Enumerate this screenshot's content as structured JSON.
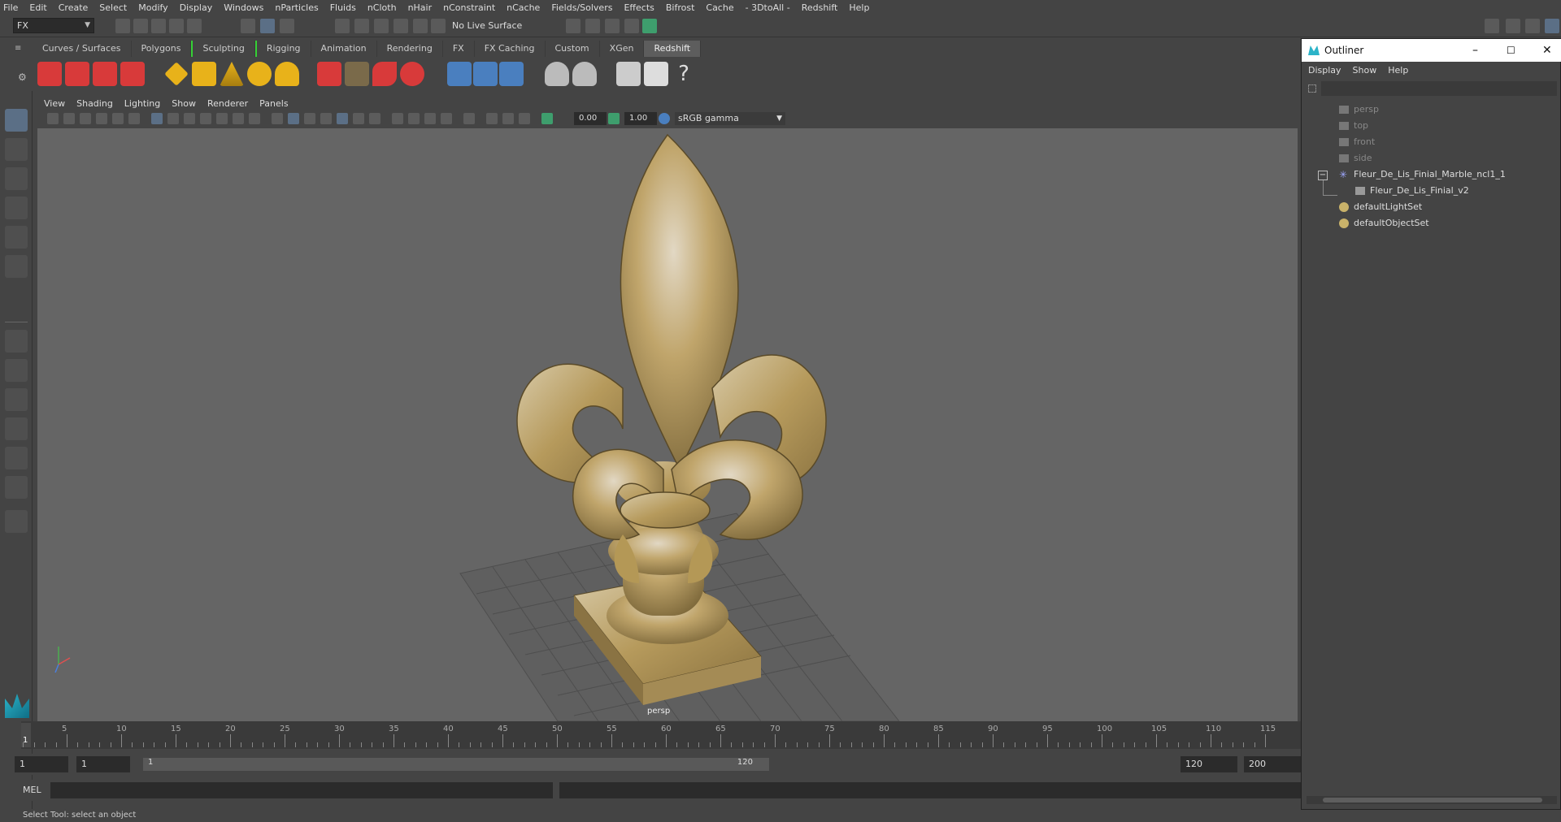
{
  "menubar": {
    "items": [
      "File",
      "Edit",
      "Create",
      "Select",
      "Modify",
      "Display",
      "Windows",
      "nParticles",
      "Fluids",
      "nCloth",
      "nHair",
      "nConstraint",
      "nCache",
      "Fields/Solvers",
      "Effects",
      "Bifrost",
      "Cache",
      "- 3DtoAll -",
      "Redshift",
      "Help"
    ]
  },
  "status_line": {
    "mode": "FX",
    "live_surface": "No Live Surface"
  },
  "shelf": {
    "tabs": [
      "Curves / Surfaces",
      "Polygons",
      "Sculpting",
      "Rigging",
      "Animation",
      "Rendering",
      "FX",
      "FX Caching",
      "Custom",
      "XGen",
      "Redshift"
    ],
    "active_tab": "Redshift"
  },
  "viewport": {
    "menu": [
      "View",
      "Shading",
      "Lighting",
      "Show",
      "Renderer",
      "Panels"
    ],
    "exposure": "0.00",
    "gamma": "1.00",
    "color_space": "sRGB gamma",
    "camera_label": "persp"
  },
  "timeline": {
    "ticks": [
      "5",
      "10",
      "15",
      "20",
      "25",
      "30",
      "35",
      "40",
      "45",
      "50",
      "55",
      "60",
      "65",
      "70",
      "75",
      "80",
      "85",
      "90",
      "95",
      "100",
      "105",
      "110",
      "115"
    ],
    "current_frame": "1"
  },
  "range": {
    "start": "1",
    "playback_start": "1",
    "slider_start": "1",
    "slider_end": "120",
    "playback_end": "120",
    "end": "200"
  },
  "command": {
    "label": "MEL"
  },
  "help_line": "Select Tool: select an object",
  "outliner": {
    "title": "Outliner",
    "menu": [
      "Display",
      "Show",
      "Help"
    ],
    "items": [
      {
        "label": "persp",
        "dim": true
      },
      {
        "label": "top",
        "dim": true
      },
      {
        "label": "front",
        "dim": true
      },
      {
        "label": "side",
        "dim": true
      },
      {
        "label": "Fleur_De_Lis_Finial_Marble_ncl1_1",
        "dim": false
      },
      {
        "label": "Fleur_De_Lis_Finial_v2",
        "dim": false
      },
      {
        "label": "defaultLightSet",
        "dim": false
      },
      {
        "label": "defaultObjectSet",
        "dim": false
      }
    ]
  },
  "colors": {
    "accent": "#5b6f86",
    "shelf_green": "#36d136",
    "statue": "#b69a62"
  }
}
